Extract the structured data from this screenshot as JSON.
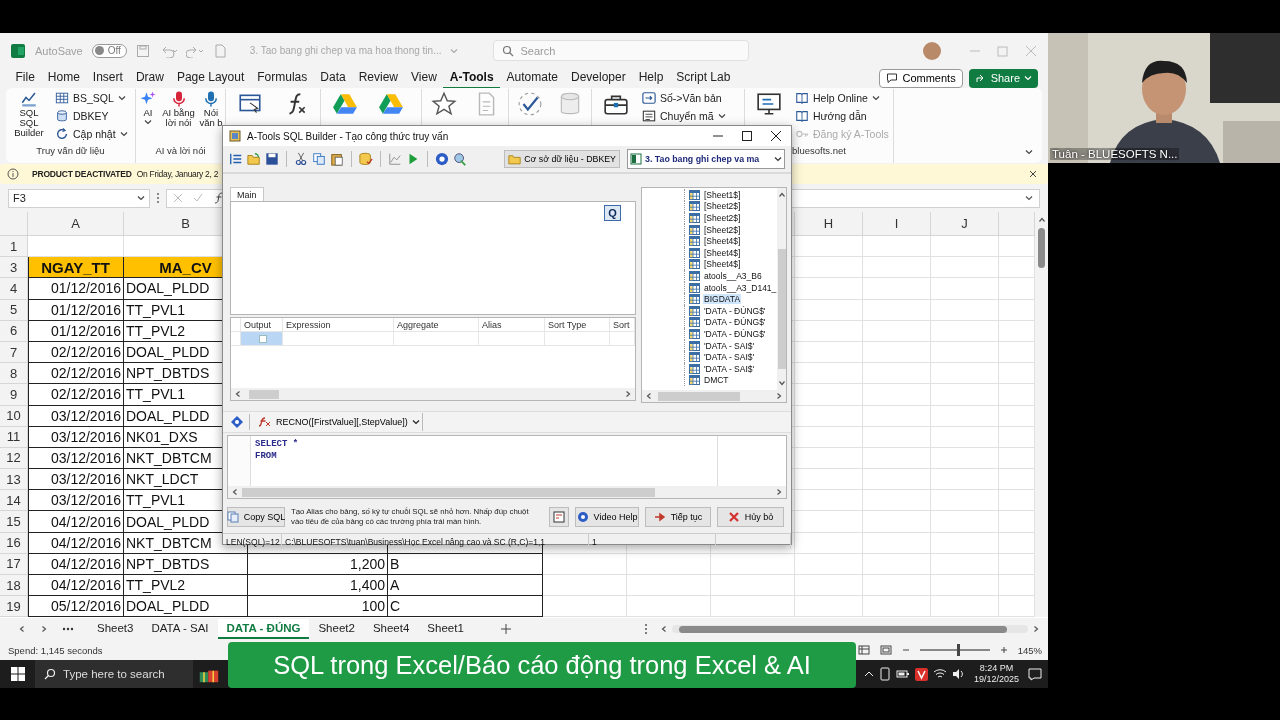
{
  "title_bar": {
    "autosave_label": "AutoSave",
    "autosave_on": false,
    "autosave_state": "Off",
    "document_title": "3. Tao bang ghi chep va ma hoa thong tin...",
    "search_placeholder": "Search"
  },
  "menu_tabs": [
    {
      "label": "File",
      "selected": false
    },
    {
      "label": "Home",
      "selected": false
    },
    {
      "label": "Insert",
      "selected": false
    },
    {
      "label": "Draw",
      "selected": false
    },
    {
      "label": "Page Layout",
      "selected": false
    },
    {
      "label": "Formulas",
      "selected": false
    },
    {
      "label": "Data",
      "selected": false
    },
    {
      "label": "Review",
      "selected": false
    },
    {
      "label": "View",
      "selected": false
    },
    {
      "label": "A-Tools",
      "selected": true
    },
    {
      "label": "Automate",
      "selected": false
    },
    {
      "label": "Developer",
      "selected": false
    },
    {
      "label": "Help",
      "selected": false
    },
    {
      "label": "Script Lab",
      "selected": false
    }
  ],
  "comments_button": "Comments",
  "share_button": "Share",
  "ribbon_groups": [
    {
      "label": "Truy vấn dữ liệu",
      "items": [
        {
          "kind": "large",
          "label": "SQL\nSQL\nBuilder",
          "caret": false
        },
        {
          "kind": "stack",
          "items": [
            {
              "label": "BS_SQL",
              "caret": true,
              "disabled": false
            },
            {
              "label": "DBKEY",
              "caret": false,
              "disabled": false
            },
            {
              "label": "Cập nhật",
              "caret": true,
              "disabled": false
            }
          ]
        }
      ]
    },
    {
      "label": "AI và lời nói",
      "items": [
        {
          "kind": "large",
          "label": "AI",
          "caret": true
        },
        {
          "kind": "large",
          "label": "AI bằng\nlời nói",
          "caret": false
        },
        {
          "kind": "large",
          "label": "Nói\nvăn b",
          "caret": false
        }
      ]
    },
    {
      "items": [
        {
          "kind": "icon",
          "disabled": false
        },
        {
          "kind": "icon",
          "disabled": false
        }
      ]
    },
    {
      "items": [
        {
          "kind": "icon",
          "disabled": false
        },
        {
          "kind": "icon",
          "disabled": false
        }
      ]
    },
    {
      "items": [
        {
          "kind": "icon",
          "disabled": false
        },
        {
          "kind": "icon",
          "disabled": true
        }
      ]
    },
    {
      "items": [
        {
          "kind": "icon",
          "disabled": false
        },
        {
          "kind": "icon",
          "disabled": true
        }
      ]
    },
    {
      "items": [
        {
          "kind": "icon",
          "disabled": false
        },
        {
          "kind": "stack",
          "items": [
            {
              "label": "Số->Văn bản",
              "caret": false,
              "disabled": false
            },
            {
              "label": "Chuyển mã",
              "caret": true,
              "disabled": false
            }
          ]
        }
      ]
    },
    {
      "label": "bluesofts.net",
      "items": [
        {
          "kind": "icon",
          "disabled": false
        },
        {
          "kind": "stack",
          "items": [
            {
              "label": "Help Online",
              "caret": true,
              "disabled": false
            },
            {
              "label": "Hướng dẫn",
              "caret": false,
              "disabled": false
            },
            {
              "label": "Đăng ký A-Tools",
              "caret": false,
              "disabled": true
            }
          ]
        }
      ]
    }
  ],
  "notice": {
    "title": "PRODUCT DEACTIVATED",
    "text": "On Friday, January 2, 2"
  },
  "name_box": "F3",
  "column_headers": [
    "A",
    "B",
    "H",
    "I",
    "J"
  ],
  "rows": [
    {
      "number": "1",
      "kind": "blank"
    },
    {
      "number": "3",
      "kind": "header",
      "cells": [
        "NGAY_TT",
        "MA_CV"
      ]
    },
    {
      "number": "4",
      "kind": "data",
      "cells": [
        "01/12/2016",
        "DOAL_PLDD"
      ]
    },
    {
      "number": "5",
      "kind": "data",
      "cells": [
        "01/12/2016",
        "TT_PVL1"
      ]
    },
    {
      "number": "6",
      "kind": "data",
      "cells": [
        "01/12/2016",
        "TT_PVL2"
      ]
    },
    {
      "number": "7",
      "kind": "data",
      "cells": [
        "02/12/2016",
        "DOAL_PLDD"
      ]
    },
    {
      "number": "8",
      "kind": "data",
      "cells": [
        "02/12/2016",
        "NPT_DBTDS"
      ]
    },
    {
      "number": "9",
      "kind": "data",
      "cells": [
        "02/12/2016",
        "TT_PVL1"
      ]
    },
    {
      "number": "10",
      "kind": "data",
      "cells": [
        "03/12/2016",
        "DOAL_PLDD"
      ]
    },
    {
      "number": "11",
      "kind": "data",
      "cells": [
        "03/12/2016",
        "NK01_DXS"
      ]
    },
    {
      "number": "12",
      "kind": "data",
      "cells": [
        "03/12/2016",
        "NKT_DBTCM"
      ]
    },
    {
      "number": "13",
      "kind": "data",
      "cells": [
        "03/12/2016",
        "NKT_LDCT"
      ]
    },
    {
      "number": "14",
      "kind": "data",
      "cells": [
        "03/12/2016",
        "TT_PVL1"
      ]
    },
    {
      "number": "15",
      "kind": "data",
      "cells": [
        "04/12/2016",
        "DOAL_PLDD"
      ]
    },
    {
      "number": "16",
      "kind": "data",
      "cells": [
        "04/12/2016",
        "NKT_DBTCM"
      ]
    },
    {
      "number": "17",
      "kind": "data",
      "cells": [
        "04/12/2016",
        "NPT_DBTDS",
        "1,200",
        "B"
      ]
    },
    {
      "number": "18",
      "kind": "data",
      "cells": [
        "04/12/2016",
        "TT_PVL2",
        "1,400",
        "A"
      ]
    },
    {
      "number": "19",
      "kind": "data",
      "cells": [
        "05/12/2016",
        "DOAL_PLDD",
        "100",
        "C"
      ]
    }
  ],
  "sheet_tabs": [
    {
      "label": "Sheet3",
      "selected": false
    },
    {
      "label": "DATA - SAI",
      "selected": false
    },
    {
      "label": "DATA - ĐÚNG",
      "selected": true
    },
    {
      "label": "Sheet2",
      "selected": false
    },
    {
      "label": "Sheet4",
      "selected": false
    },
    {
      "label": "Sheet1",
      "selected": false
    }
  ],
  "status_bar": {
    "text": "Spend: 1,145 seconds",
    "zoom": "145%",
    "zoom_slider": {
      "level": 0.55
    }
  },
  "taskbar": {
    "search_placeholder": "Type here to search",
    "time": "8:24 PM",
    "date": "19/12/2025"
  },
  "dialog": {
    "title": "A-Tools SQL Builder - Tạo công thức truy vấn",
    "database_button": "Cơ sở dữ liệu - DBKEY",
    "workbook_dropdown": "3. Tao bang ghi chep va ma",
    "tabs": [
      {
        "label": "Main",
        "selected": true
      }
    ],
    "query_button": "Q",
    "grid_columns": [
      "Output",
      "Expression",
      "Aggregate",
      "Alias",
      "Sort Type",
      "Sort"
    ],
    "grid_rows": [
      {
        "selected": true,
        "output_checked": false
      }
    ],
    "tables": [
      {
        "name": "[Sheet1$]",
        "selected": false
      },
      {
        "name": "[Sheet2$]",
        "selected": false
      },
      {
        "name": "[Sheet2$]",
        "selected": false
      },
      {
        "name": "[Sheet2$]",
        "selected": false
      },
      {
        "name": "[Sheet4$]",
        "selected": false
      },
      {
        "name": "[Sheet4$]",
        "selected": false
      },
      {
        "name": "[Sheet4$]",
        "selected": false
      },
      {
        "name": "atools__A3_B6",
        "selected": false
      },
      {
        "name": "atools__A3_D141_",
        "selected": false
      },
      {
        "name": "BIGDATA",
        "selected": true
      },
      {
        "name": "'DATA - ĐÚNG$'",
        "selected": false
      },
      {
        "name": "'DATA - ĐÚNG$'",
        "selected": false
      },
      {
        "name": "'DATA - ĐÚNG$'",
        "selected": false
      },
      {
        "name": "'DATA - SAI$'",
        "selected": false
      },
      {
        "name": "'DATA - SAI$'",
        "selected": false
      },
      {
        "name": "'DATA - SAI$'",
        "selected": false
      },
      {
        "name": "DMCT",
        "selected": false
      }
    ],
    "function_dropdown": "RECNO([FirstValue][,StepValue])",
    "sql_lines": [
      "SELECT *",
      "FROM"
    ],
    "copy_button": "Copy SQL",
    "hint": "Tạo Alias cho bảng, số ký tự chuỗi SQL sẽ nhỏ hơn. Nhấp đúp chuột vào tiêu đề của bảng có các trường phía trái màn hình.",
    "action_buttons": [
      "Video Help",
      "Tiếp tục",
      "Hủy bỏ"
    ],
    "status": [
      "LEN(SQL)=12",
      "C:\\BLUESOFTS\\tuan\\Business\\Học Excel nâng cao và SC (R,C)=1,1",
      "1"
    ]
  },
  "caption_banner": "SQL trong Excel/Báo cáo động trong Excel & AI",
  "webcam": {
    "kind": "picture",
    "name_label": "Tuân - BLUESOFTS N..."
  }
}
